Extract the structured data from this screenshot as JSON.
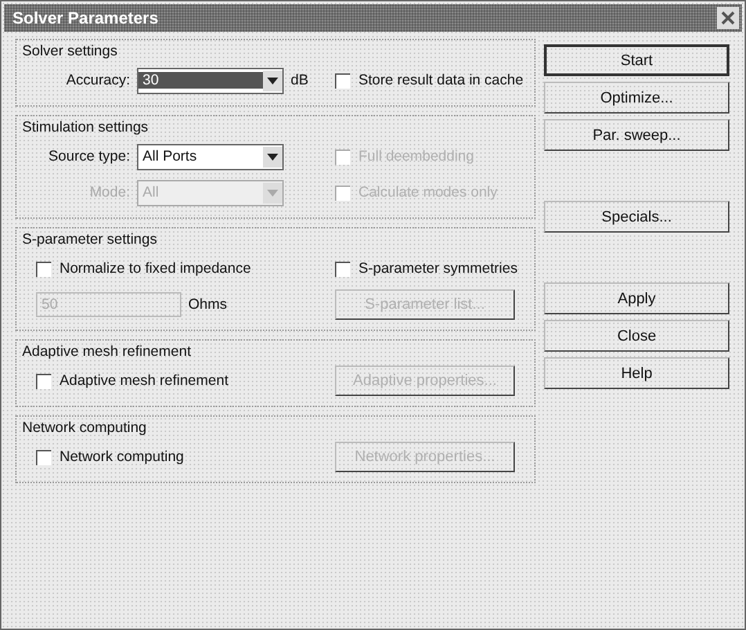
{
  "window": {
    "title": "Solver Parameters"
  },
  "groups": [
    {
      "title": "Solver settings",
      "rows": [
        {
          "left": [
            {
              "kind": "label",
              "text": "Accuracy:",
              "disabled": false
            },
            {
              "kind": "combo",
              "value": "30",
              "highlighted": true,
              "disabled": false
            },
            {
              "kind": "unit",
              "text": "dB",
              "disabled": false
            }
          ],
          "right": [
            {
              "kind": "checkbox",
              "text": "Store result data in cache",
              "checked": false,
              "disabled": false
            }
          ]
        }
      ]
    },
    {
      "title": "Stimulation settings",
      "rows": [
        {
          "left": [
            {
              "kind": "label",
              "text": "Source type:",
              "disabled": false
            },
            {
              "kind": "combo",
              "value": "All Ports",
              "highlighted": false,
              "disabled": false
            }
          ],
          "right": [
            {
              "kind": "checkbox",
              "text": "Full deembedding",
              "checked": false,
              "disabled": true
            }
          ]
        },
        {
          "left": [
            {
              "kind": "label",
              "text": "Mode:",
              "disabled": true
            },
            {
              "kind": "combo",
              "value": "All",
              "highlighted": false,
              "disabled": true
            }
          ],
          "right": [
            {
              "kind": "checkbox",
              "text": "Calculate modes only",
              "checked": false,
              "disabled": true
            }
          ]
        }
      ]
    },
    {
      "title": "S-parameter settings",
      "rows": [
        {
          "left": [
            {
              "kind": "checkbox",
              "text": "Normalize to fixed impedance",
              "checked": false,
              "disabled": false
            }
          ],
          "right": [
            {
              "kind": "checkbox",
              "text": "S-parameter symmetries",
              "checked": false,
              "disabled": false
            }
          ]
        },
        {
          "left": [
            {
              "kind": "input",
              "value": "50",
              "disabled": true
            },
            {
              "kind": "unit",
              "text": "Ohms",
              "disabled": false
            }
          ],
          "right": [
            {
              "kind": "button",
              "text": "S-parameter list...",
              "disabled": true
            }
          ]
        }
      ]
    },
    {
      "title": "Adaptive mesh refinement",
      "rows": [
        {
          "left": [
            {
              "kind": "checkbox",
              "text": "Adaptive mesh refinement",
              "checked": false,
              "disabled": false
            }
          ],
          "right": [
            {
              "kind": "button",
              "text": "Adaptive properties...",
              "disabled": true
            }
          ]
        }
      ]
    },
    {
      "title": "Network computing",
      "rows": [
        {
          "left": [
            {
              "kind": "checkbox",
              "text": "Network computing",
              "checked": false,
              "disabled": false
            }
          ],
          "right": [
            {
              "kind": "button",
              "text": "Network properties...",
              "disabled": true
            }
          ]
        }
      ]
    }
  ],
  "button_groups": [
    [
      {
        "label": "Start",
        "default": true
      },
      {
        "label": "Optimize...",
        "default": false
      },
      {
        "label": "Par. sweep...",
        "default": false
      }
    ],
    [
      {
        "label": "Specials...",
        "default": false
      }
    ],
    [
      {
        "label": "Apply",
        "default": false
      },
      {
        "label": "Close",
        "default": false
      },
      {
        "label": "Help",
        "default": false
      }
    ]
  ]
}
